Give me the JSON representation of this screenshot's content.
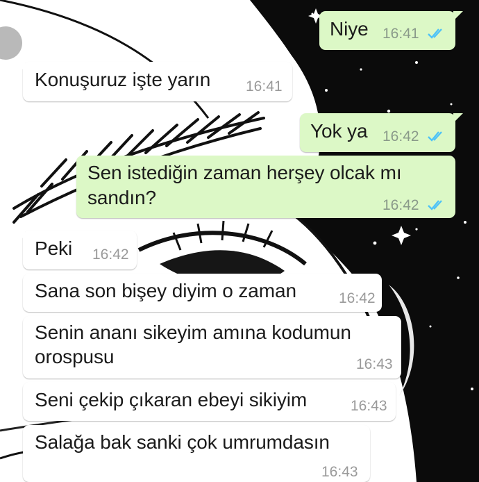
{
  "messages": [
    {
      "id": 1,
      "direction": "outgoing",
      "text": "Niye",
      "time": "16:41",
      "status": "read-double-check-icon"
    },
    {
      "id": 2,
      "direction": "incoming",
      "text": "Konuşuruz işte yarın",
      "time": "16:41"
    },
    {
      "id": 3,
      "direction": "outgoing",
      "text": "Yok ya",
      "time": "16:42",
      "status": "read-double-check-icon"
    },
    {
      "id": 4,
      "direction": "outgoing",
      "lines": [
        "Sen istediğin zaman herşey olcak mı",
        "sandın?"
      ],
      "time": "16:42",
      "status": "read-double-check-icon"
    },
    {
      "id": 5,
      "direction": "incoming",
      "text": "Peki",
      "time": "16:42"
    },
    {
      "id": 6,
      "direction": "incoming",
      "text": "Sana son bişey diyim o zaman",
      "time": "16:42"
    },
    {
      "id": 7,
      "direction": "incoming",
      "lines": [
        "Senin ananı sikeyim amına kodumun",
        "orospusu"
      ],
      "time": "16:43"
    },
    {
      "id": 8,
      "direction": "incoming",
      "text": "Seni çekip çıkaran ebeyi sikiyim",
      "time": "16:43"
    },
    {
      "id": 9,
      "direction": "incoming",
      "text": "Salağa bak sanki çok umrumdasın",
      "time": "16:43"
    }
  ],
  "colors": {
    "incoming_bubble": "#ffffff",
    "outgoing_bubble": "#dcf8c6",
    "read_tick": "#4fc3f7",
    "wallpaper_dark": "#0a0a0a",
    "wallpaper_light": "#ffffff"
  },
  "wallpaper": "anime-face-starry-night-illustration"
}
